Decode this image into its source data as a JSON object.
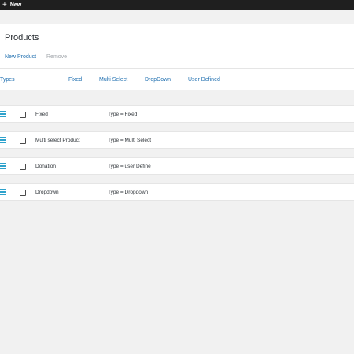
{
  "topbar": {
    "new_label": "New"
  },
  "header": {
    "title": "Products",
    "actions": {
      "new_product": "New Product",
      "remove": "Remove"
    }
  },
  "tabs": {
    "types": "Types",
    "fixed": "Fixed",
    "multi_select": "Multi Select",
    "dropdown": "DropDown",
    "user_defined": "User Defined"
  },
  "rows": [
    {
      "name": "Fixed",
      "type": "Type = Fixed"
    },
    {
      "name": "Multi select Product",
      "type": "Type = Multi Select"
    },
    {
      "name": "Donation",
      "type": "Type = user Define"
    },
    {
      "name": "Dropdown",
      "type": "Type = Dropdown"
    }
  ],
  "colors": {
    "link": "#2271b1",
    "muted": "#a0a5aa",
    "drag_icon": "#2ea2cc",
    "topbar": "#1f1f1f",
    "background": "#f1f1f1"
  },
  "icons": {
    "new": "plus-icon",
    "drag": "drag-handle-icon",
    "select": "checkbox-icon"
  }
}
